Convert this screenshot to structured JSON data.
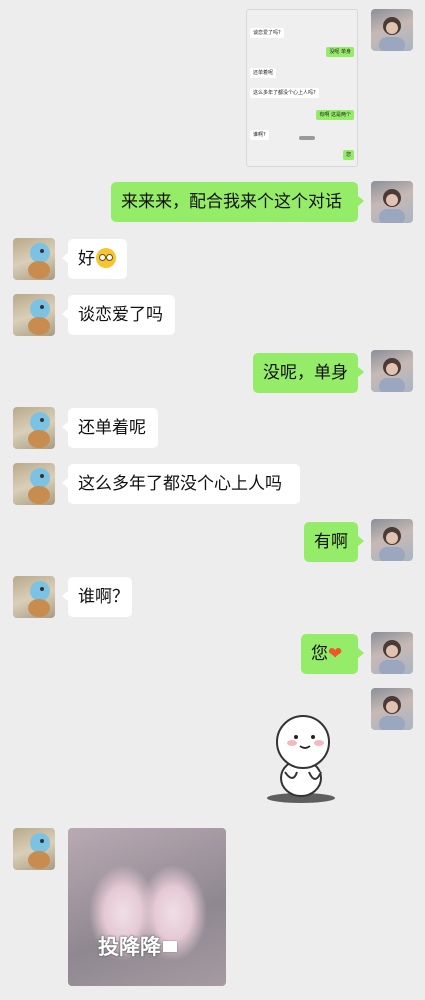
{
  "screenshot_thumb": {
    "messages": [
      {
        "side": "left",
        "text": "谈恋爱了吗?"
      },
      {
        "side": "right",
        "text": "没呢 单身"
      },
      {
        "side": "left",
        "text": "还单着呢"
      },
      {
        "side": "left",
        "text": "这么多年了都没个心上人吗?"
      },
      {
        "side": "right",
        "text": "有啊 这是两个"
      },
      {
        "side": "left",
        "text": "谁啊?"
      },
      {
        "side": "right",
        "text": "您"
      }
    ]
  },
  "messages": [
    {
      "id": "m1",
      "sender": "me",
      "text": "来来来，配合我来个这个对话"
    },
    {
      "id": "m2",
      "sender": "friend",
      "text": "好",
      "emoji": "flushed-face"
    },
    {
      "id": "m3",
      "sender": "friend",
      "text": "谈恋爱了吗"
    },
    {
      "id": "m4",
      "sender": "me",
      "text": "没呢，单身"
    },
    {
      "id": "m5",
      "sender": "friend",
      "text": "还单着呢"
    },
    {
      "id": "m6",
      "sender": "friend",
      "text": "这么多年了都没个心上人吗"
    },
    {
      "id": "m7",
      "sender": "me",
      "text": "有啊"
    },
    {
      "id": "m8",
      "sender": "friend",
      "text": "谁啊？"
    },
    {
      "id": "m9",
      "sender": "me",
      "text": "您",
      "emoji": "heart"
    },
    {
      "id": "m10",
      "sender": "me",
      "type": "sticker",
      "sticker": "shy-white-blob"
    },
    {
      "id": "m11",
      "sender": "friend",
      "type": "image",
      "caption": "投降降"
    }
  ],
  "colors": {
    "chat_bg": "#ededed",
    "bubble_green": "#95ec69",
    "bubble_white": "#ffffff",
    "heart": "#f0562a"
  }
}
